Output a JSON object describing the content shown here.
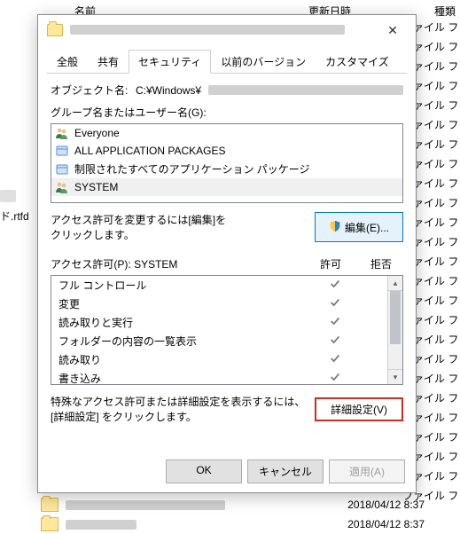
{
  "explorer_header": {
    "name": "名前",
    "updated": "更新日時",
    "kind": "種類"
  },
  "explorer_kind_value": "ファイル フォル",
  "explorer_left_item": "ド.rtfd",
  "explorer_bottom": {
    "date1": "2018/04/12 8:37",
    "date2": "2018/04/12 8:37"
  },
  "dialog": {
    "close_label": "✕",
    "tabs": [
      "全般",
      "共有",
      "セキュリティ",
      "以前のバージョン",
      "カスタマイズ"
    ],
    "active_tab_index": 2,
    "object_label": "オブジェクト名:",
    "object_value_prefix": "C:¥Windows¥",
    "groups_label": "グループ名またはユーザー名(G):",
    "group_items": [
      {
        "name": "Everyone",
        "icon": "users"
      },
      {
        "name": "ALL APPLICATION PACKAGES",
        "icon": "package"
      },
      {
        "name": "制限されたすべてのアプリケーション パッケージ",
        "icon": "package"
      },
      {
        "name": "SYSTEM",
        "icon": "users"
      }
    ],
    "selected_group_index": 3,
    "edit_text": "アクセス許可を変更するには[編集]を\nクリックします。",
    "edit_button": "編集(E)...",
    "perm_label": "アクセス許可(P): SYSTEM",
    "perm_allow": "許可",
    "perm_deny": "拒否",
    "permissions": [
      {
        "name": "フル コントロール",
        "allow": true,
        "deny": false
      },
      {
        "name": "変更",
        "allow": true,
        "deny": false
      },
      {
        "name": "読み取りと実行",
        "allow": true,
        "deny": false
      },
      {
        "name": "フォルダーの内容の一覧表示",
        "allow": true,
        "deny": false
      },
      {
        "name": "読み取り",
        "allow": true,
        "deny": false
      },
      {
        "name": "書き込み",
        "allow": true,
        "deny": false
      }
    ],
    "adv_text": "特殊なアクセス許可または詳細設定を表示するには、[詳細設定] をクリックします。",
    "adv_button": "詳細設定(V)",
    "footer": {
      "ok": "OK",
      "cancel": "キャンセル",
      "apply": "適用(A)"
    }
  }
}
